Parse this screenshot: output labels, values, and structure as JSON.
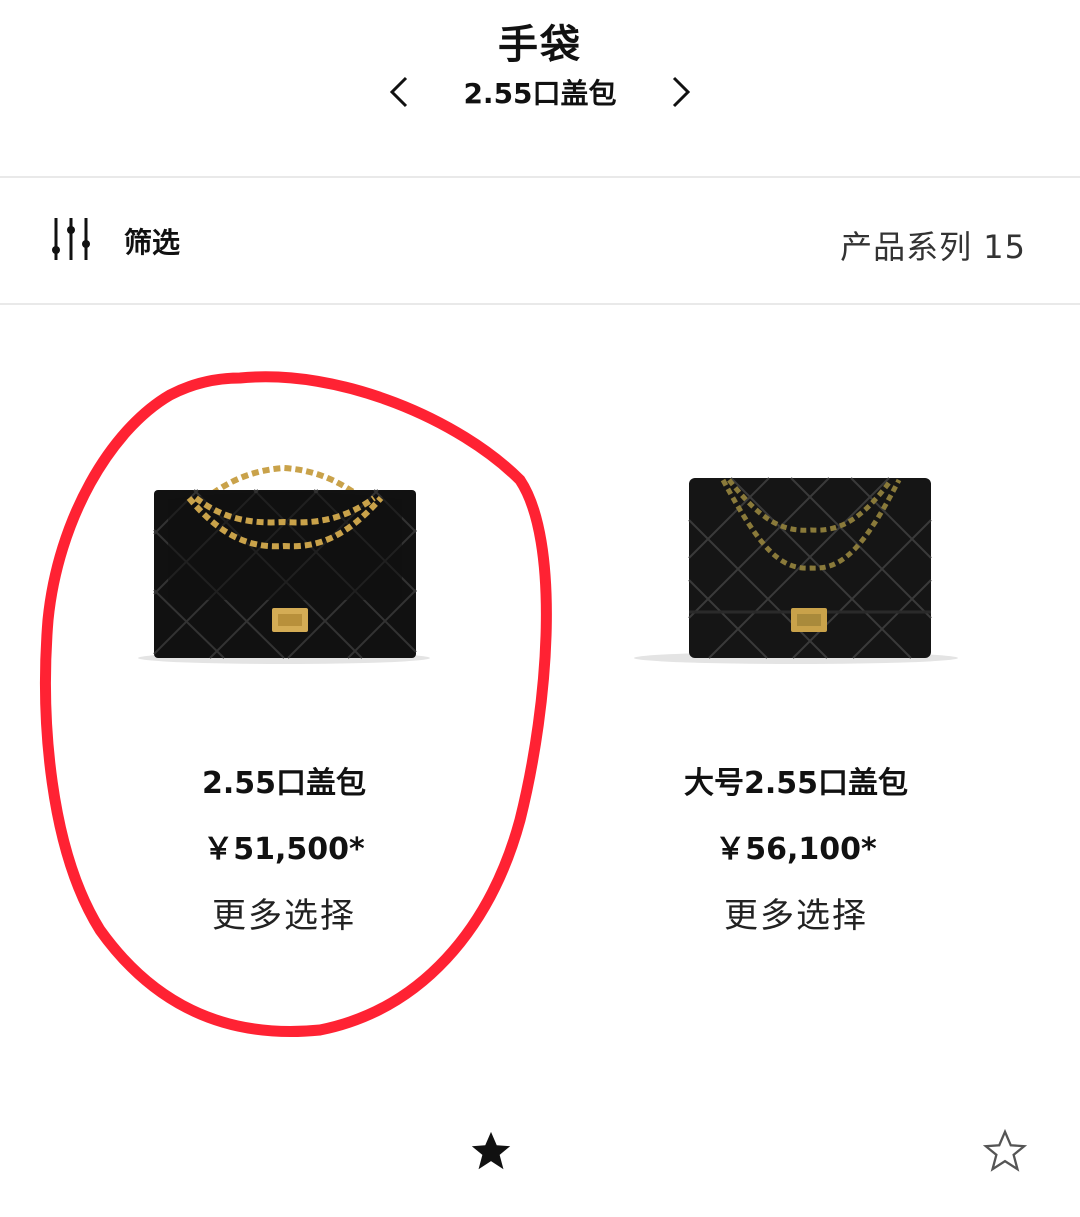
{
  "header": {
    "title": "手袋",
    "subcategory": "2.55口盖包",
    "prev_icon": "chevron-left-icon",
    "next_icon": "chevron-right-icon"
  },
  "filter_bar": {
    "filter_label": "筛选",
    "filter_icon": "sliders-icon",
    "count_label": "产品系列 15"
  },
  "products": [
    {
      "name": "2.55口盖包",
      "price": "￥51,500*",
      "more": "更多选择",
      "favorite": true
    },
    {
      "name": "大号2.55口盖包",
      "price": "￥56,100*",
      "more": "更多选择",
      "favorite": false
    }
  ],
  "annotation": {
    "shape": "hand-drawn ellipse",
    "color": "#ff2233"
  },
  "colors": {
    "text": "#111111",
    "divider": "#e9e9e9",
    "bag": "#111111",
    "chain": "#c9a24a"
  }
}
